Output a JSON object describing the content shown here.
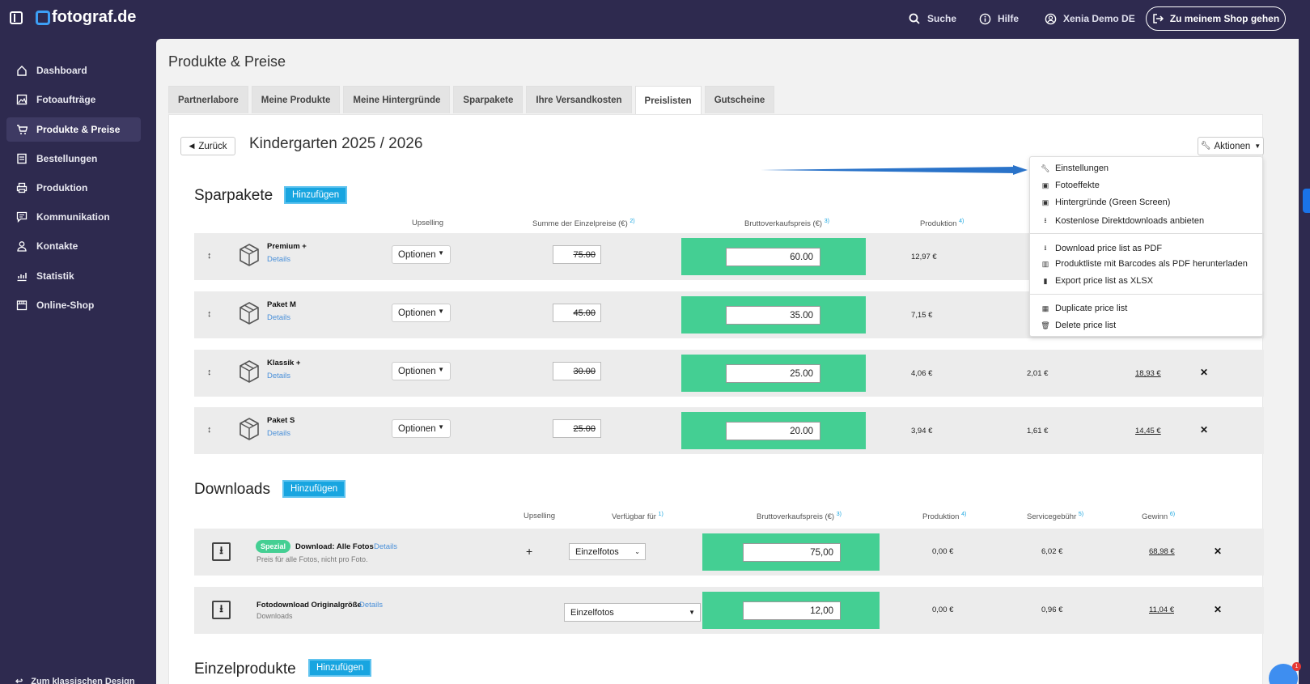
{
  "brand": {
    "name": "fotograf.de"
  },
  "topnav": {
    "search": "Suche",
    "help": "Hilfe",
    "user": "Xenia Demo DE",
    "shop_button": "Zu meinem Shop gehen"
  },
  "sidebar": {
    "items": [
      {
        "label": "Dashboard",
        "icon": "home-icon"
      },
      {
        "label": "Fotoaufträge",
        "icon": "image-icon"
      },
      {
        "label": "Produkte & Preise",
        "icon": "cart-icon"
      },
      {
        "label": "Bestellungen",
        "icon": "orders-icon"
      },
      {
        "label": "Produktion",
        "icon": "printer-icon"
      },
      {
        "label": "Kommunikation",
        "icon": "message-icon"
      },
      {
        "label": "Kontakte",
        "icon": "user-icon"
      },
      {
        "label": "Statistik",
        "icon": "chart-icon"
      },
      {
        "label": "Online-Shop",
        "icon": "store-icon"
      }
    ],
    "bottom": "Zum klassischen Design"
  },
  "page": {
    "title": "Produkte & Preise"
  },
  "tabs": [
    "Partnerlabore",
    "Meine Produkte",
    "Meine Hintergründe",
    "Sparpakete",
    "Ihre Versandkosten",
    "Preislisten",
    "Gutscheine"
  ],
  "pricelist": {
    "back": "Zurück",
    "title": "Kindergarten 2025 / 2026",
    "actions": "Aktionen"
  },
  "sparpakete": {
    "title": "Sparpakete",
    "add": "Hinzufügen",
    "columns": {
      "upselling": "Upselling",
      "sum": "Summe der Einzelpreise (€)",
      "sum_sup": "2)",
      "gross": "Bruttoverkaufspreis (€)",
      "gross_sup": "3)",
      "production": "Produktion",
      "production_sup": "4)"
    },
    "rows": [
      {
        "name": "Premium +",
        "details": "Details",
        "options": "Optionen",
        "sum": "75.00",
        "price": "60.00",
        "production": "12,97 €",
        "service": "",
        "profit": ""
      },
      {
        "name": "Paket M",
        "details": "Details",
        "options": "Optionen",
        "sum": "45.00",
        "price": "35.00",
        "production": "7,15 €",
        "service": "",
        "profit": ""
      },
      {
        "name": "Klassik +",
        "details": "Details",
        "options": "Optionen",
        "sum": "30.00",
        "price": "25.00",
        "production": "4,06 €",
        "service": "2,01 €",
        "profit": "18,93 €"
      },
      {
        "name": "Paket S",
        "details": "Details",
        "options": "Optionen",
        "sum": "25.00",
        "price": "20.00",
        "production": "3,94 €",
        "service": "1,61 €",
        "profit": "14,45 €"
      }
    ]
  },
  "downloads": {
    "title": "Downloads",
    "add": "Hinzufügen",
    "columns": {
      "upselling": "Upselling",
      "available": "Verfügbar für",
      "available_sup": "1)",
      "gross": "Bruttoverkaufspreis (€)",
      "gross_sup": "3)",
      "production": "Produktion",
      "production_sup": "4)",
      "service": "Servicegebühr",
      "service_sup": "5)",
      "profit": "Gewinn",
      "profit_sup": "6)"
    },
    "rows": [
      {
        "badge": "Spezial",
        "name": "Download: Alle Fotos",
        "details": "Details",
        "sub": "Preis für alle Fotos, nicht pro Foto.",
        "upsell": "+",
        "available": "Einzelfotos",
        "price": "75,00",
        "production": "0,00 €",
        "service": "6,02 €",
        "profit": "68,98 €"
      },
      {
        "badge": "",
        "name": "Fotodownload Originalgröße",
        "details": "Details",
        "sub": "Downloads",
        "upsell": "",
        "available": "Einzelfotos",
        "price": "12,00",
        "production": "0,00 €",
        "service": "0,96 €",
        "profit": "11,04 €"
      }
    ]
  },
  "einzelprodukte": {
    "title": "Einzelprodukte",
    "add": "Hinzufügen"
  },
  "actions_menu": {
    "items": [
      {
        "label": "Einstellungen",
        "icon": "wrench-icon"
      },
      {
        "label": "Fotoeffekte",
        "icon": "image-icon"
      },
      {
        "label": "Hintergründe (Green Screen)",
        "icon": "image-icon"
      },
      {
        "label": "Kostenlose Direktdownloads anbieten",
        "icon": "download-icon"
      },
      {
        "label": "Download price list as PDF",
        "icon": "download-icon"
      },
      {
        "label": "Produktliste mit Barcodes als PDF herunterladen",
        "icon": "barcode-icon"
      },
      {
        "label": "Export price list as XLSX",
        "icon": "file-icon"
      },
      {
        "label": "Duplicate price list",
        "icon": "table-icon"
      },
      {
        "label": "Delete price list",
        "icon": "trash-icon"
      }
    ]
  },
  "chat": {
    "badge": "1"
  },
  "colors": {
    "sidebar": "#2e2a4f",
    "accent": "#18a5e0",
    "price_green": "#44cf93"
  }
}
